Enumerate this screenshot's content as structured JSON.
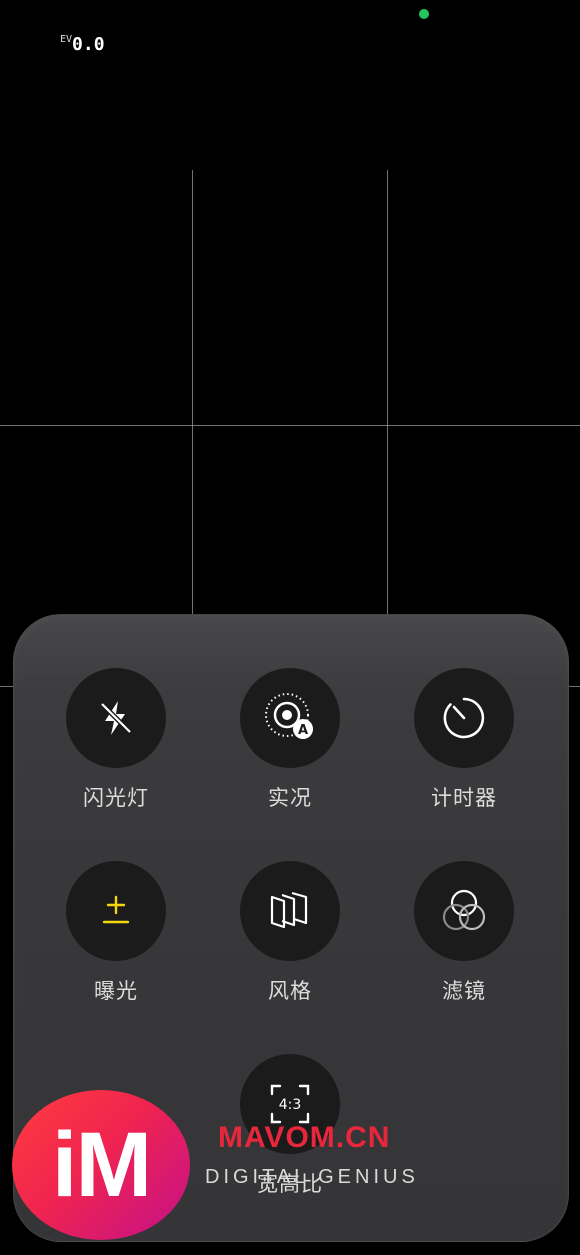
{
  "status": {
    "ev_label": "EV",
    "ev_value": "0.0",
    "indicator_color": "#22c55e"
  },
  "quick_settings": {
    "tiles": [
      {
        "label": "闪光灯",
        "icon": "flash-off-icon"
      },
      {
        "label": "实况",
        "icon": "live-photo-auto-icon"
      },
      {
        "label": "计时器",
        "icon": "timer-icon"
      },
      {
        "label": "曝光",
        "icon": "exposure-plus-minus-icon",
        "accent": "#f5d50b"
      },
      {
        "label": "风格",
        "icon": "style-layers-icon"
      },
      {
        "label": "滤镜",
        "icon": "filter-circles-icon"
      },
      {
        "label": "宽高比",
        "icon": "aspect-ratio-icon",
        "value": "4:3"
      }
    ]
  },
  "watermark": {
    "logo_text": "iM",
    "site": "MAVOM.CN",
    "tagline": "DIGITAL GENIUS",
    "brand_color": "#e8273c"
  }
}
